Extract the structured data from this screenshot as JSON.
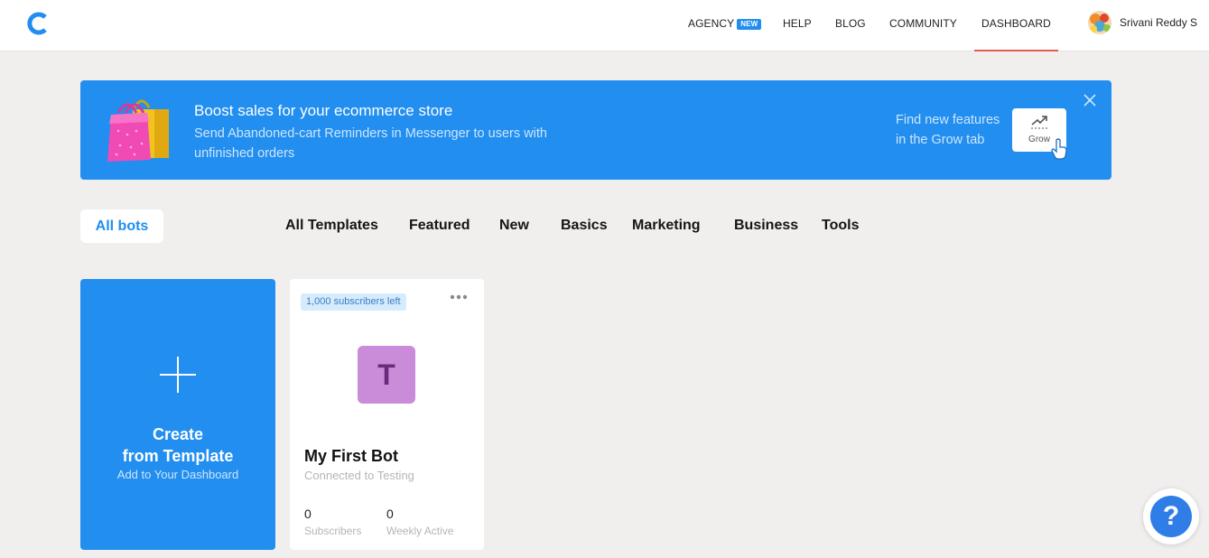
{
  "header": {
    "nav": [
      {
        "label": "AGENCY",
        "badge": "NEW"
      },
      {
        "label": "HELP"
      },
      {
        "label": "BLOG"
      },
      {
        "label": "COMMUNITY"
      },
      {
        "label": "DASHBOARD",
        "active": true
      }
    ],
    "user_name": "Srivani Reddy S",
    "logo_icon": "chatfuel-logo-icon",
    "accent_color": "#218ef0",
    "active_underline_color": "#e45d4f"
  },
  "banner": {
    "title": "Boost sales for your ecommerce store",
    "text": "Send Abandoned-cart Reminders in Messenger to users with unfinished orders",
    "hint": "Find new features in the Grow tab",
    "grow_label": "Grow",
    "close_icon": "close-icon"
  },
  "tabs": {
    "all_bots": "All bots",
    "items": [
      "All Templates",
      "Featured",
      "New",
      "Basics",
      "Marketing",
      "Business",
      "Tools"
    ]
  },
  "create_card": {
    "title_line1": "Create",
    "title_line2": "from Template",
    "subtitle": "Add to Your Dashboard"
  },
  "bot_card": {
    "badge": "1,000 subscribers left",
    "avatar_letter": "T",
    "name": "My First Bot",
    "connection": "Connected to Testing",
    "subscribers_value": "0",
    "subscribers_label": "Subscribers",
    "weekly_value": "0",
    "weekly_label": "Weekly Active"
  },
  "help": {
    "symbol": "?"
  }
}
